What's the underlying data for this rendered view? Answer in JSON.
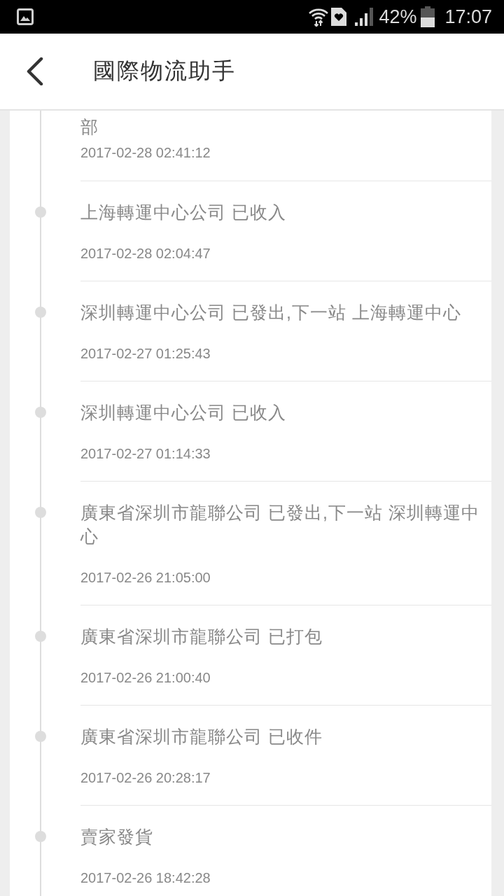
{
  "status_bar": {
    "battery": "42%",
    "time": "17:07"
  },
  "app_bar": {
    "title": "國際物流助手"
  },
  "timeline": [
    {
      "title": "部",
      "time": "2017-02-28 02:41:12"
    },
    {
      "title": "上海轉運中心公司 已收入",
      "time": "2017-02-28 02:04:47"
    },
    {
      "title": "深圳轉運中心公司 已發出,下一站 上海轉運中心",
      "time": "2017-02-27 01:25:43"
    },
    {
      "title": "深圳轉運中心公司 已收入",
      "time": "2017-02-27 01:14:33"
    },
    {
      "title": "廣東省深圳市龍聯公司 已發出,下一站 深圳轉運中心",
      "time": "2017-02-26 21:05:00"
    },
    {
      "title": "廣東省深圳市龍聯公司 已打包",
      "time": "2017-02-26 21:00:40"
    },
    {
      "title": "廣東省深圳市龍聯公司 已收件",
      "time": "2017-02-26 20:28:17"
    },
    {
      "title": "賣家發貨",
      "time": "2017-02-26 18:42:28"
    }
  ]
}
